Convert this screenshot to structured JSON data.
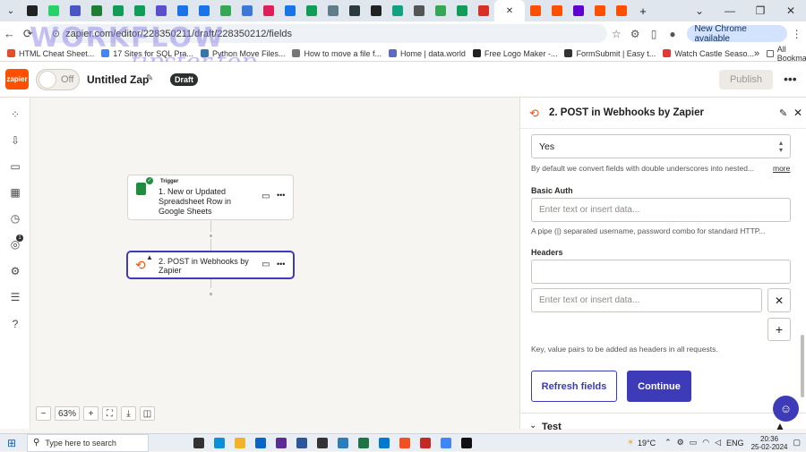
{
  "browser": {
    "tabs": [
      {
        "icon": "github-icon",
        "color": "#222222"
      },
      {
        "icon": "whatsapp-icon",
        "color": "#25d366"
      },
      {
        "icon": "docs-icon",
        "color": "#4a56c8"
      },
      {
        "icon": "sheets-icon",
        "color": "#1e7e34"
      },
      {
        "icon": "s-icon",
        "color": "#0f9d58"
      },
      {
        "icon": "s-icon",
        "color": "#0f9d58"
      },
      {
        "icon": "s-icon",
        "color": "#5a4fcf"
      },
      {
        "icon": "diamond-icon",
        "color": "#1a73e8"
      },
      {
        "icon": "diamond-icon",
        "color": "#1a73e8"
      },
      {
        "icon": "drive-icon",
        "color": "#34a853"
      },
      {
        "icon": "forms-icon",
        "color": "#3c78d8"
      },
      {
        "icon": "slack-icon",
        "color": "#e01e5a"
      },
      {
        "icon": "chrome-icon",
        "color": "#1a73e8"
      },
      {
        "icon": "plus-icon",
        "color": "#0f9d58"
      },
      {
        "icon": "image-icon",
        "color": "#607d8b"
      },
      {
        "icon": "dark-app-icon",
        "color": "#2b3a3f"
      },
      {
        "icon": "github-icon",
        "color": "#222222"
      },
      {
        "icon": "chatgpt-icon",
        "color": "#10a37f"
      },
      {
        "icon": "window-icon",
        "color": "#555555"
      },
      {
        "icon": "drive-icon",
        "color": "#34a853"
      },
      {
        "icon": "plus-icon",
        "color": "#0f9d58"
      },
      {
        "icon": "heart-icon",
        "color": "#d93025"
      },
      {
        "icon": "zapier-icon",
        "color": "#ff4f00"
      },
      {
        "icon": "zapier-icon",
        "color": "#ff4f00"
      },
      {
        "icon": "yahoo-icon",
        "color": "#6001d2"
      },
      {
        "icon": "zapier-icon",
        "color": "#ff4f00"
      },
      {
        "icon": "zapier-icon",
        "color": "#ff4f00"
      }
    ],
    "window_controls": [
      "⌄",
      "—",
      "❐",
      "✕"
    ],
    "new_tab": "+",
    "url": "zapier.com/editor/228350211/draft/228350212/fields",
    "new_chrome": "New Chrome available",
    "bookmarks": [
      {
        "label": "HTML Cheat Sheet...",
        "color": "#e44d26"
      },
      {
        "label": "17 Sites for SQL Pra...",
        "color": "#4285f4"
      },
      {
        "label": "Python Move Files...",
        "color": "#3776ab"
      },
      {
        "label": "How to move a file f...",
        "color": "#777777"
      },
      {
        "label": "Home | data.world",
        "color": "#5c6bc0"
      },
      {
        "label": "Free Logo Maker -...",
        "color": "#222222"
      },
      {
        "label": "FormSubmit | Easy t...",
        "color": "#333333"
      },
      {
        "label": "Watch Castle Seaso...",
        "color": "#e53935"
      }
    ],
    "bookmarks_overflow": "»",
    "all_bookmarks": "All Bookmarks",
    "watermark_line1": "WORKFLOW",
    "watermark_line2": "tipster.top"
  },
  "zap": {
    "logo_text": "zapier",
    "toggle_label": "Off",
    "name": "Untitled Zap",
    "status_badge": "Draft",
    "publish_label": "Publish",
    "more": "•••"
  },
  "canvas": {
    "trigger": {
      "tag": "Trigger",
      "title": "1. New or Updated Spreadsheet Row in Google Sheets"
    },
    "action": {
      "title": "2. POST in Webhooks by Zapier"
    },
    "zoom": {
      "minus": "−",
      "level": "63%",
      "plus": "+"
    }
  },
  "panel": {
    "title": "2. POST in Webhooks by Zapier",
    "unflatten_value": "Yes",
    "unflatten_help": "By default we convert fields with double underscores into nested...",
    "more_link": "more",
    "basic_auth_label": "Basic Auth",
    "basic_auth_placeholder": "Enter text or insert data...",
    "basic_auth_help": "A pipe (|) separated username, password combo for standard HTTP...",
    "headers_label": "Headers",
    "headers_value_placeholder": "Enter text or insert data...",
    "headers_help": "Key, value pairs to be added as headers in all requests.",
    "refresh_label": "Refresh fields",
    "continue_label": "Continue",
    "test_label": "Test"
  },
  "taskbar": {
    "search_placeholder": "Type here to search",
    "apps": [
      {
        "icon": "task-view-icon",
        "color": "#333333"
      },
      {
        "icon": "edge-icon",
        "color": "#0c8fd6"
      },
      {
        "icon": "file-explorer-icon",
        "color": "#f0b429"
      },
      {
        "icon": "mail-icon",
        "color": "#0a66c2"
      },
      {
        "icon": "vs-icon",
        "color": "#5c2d91"
      },
      {
        "icon": "word-icon",
        "color": "#2b579a"
      },
      {
        "icon": "sticky-icon",
        "color": "#333333"
      },
      {
        "icon": "photos-icon",
        "color": "#2e7dbb"
      },
      {
        "icon": "excel-icon",
        "color": "#217346"
      },
      {
        "icon": "vscode-icon",
        "color": "#007acc"
      },
      {
        "icon": "app-icon",
        "color": "#f25022"
      },
      {
        "icon": "camera-icon",
        "color": "#c62828"
      },
      {
        "icon": "chrome-icon",
        "color": "#4285f4"
      },
      {
        "icon": "terminal-icon",
        "color": "#111111"
      }
    ],
    "weather": "19°C",
    "language": "ENG",
    "time": "20:36",
    "date": "25-02-2024"
  }
}
